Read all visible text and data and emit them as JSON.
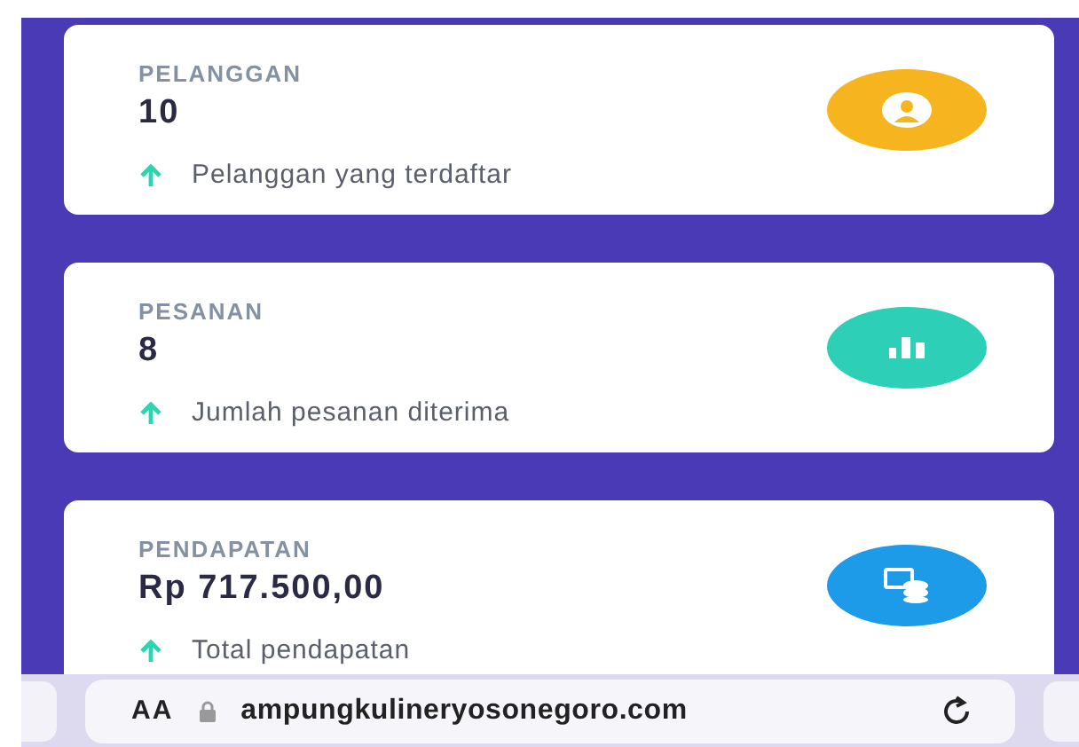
{
  "cards": [
    {
      "label": "PELANGGAN",
      "value": "10",
      "note": "Pelanggan yang terdaftar",
      "kind": "user",
      "color": "#f6b51f"
    },
    {
      "label": "PESANAN",
      "value": "8",
      "note": "Jumlah pesanan diterima",
      "kind": "chart",
      "color": "#2dcfb6"
    },
    {
      "label": "PENDAPATAN",
      "value": "Rp 717.500,00",
      "note": "Total pendapatan",
      "kind": "money",
      "color": "#1e9be8"
    }
  ],
  "address_bar": {
    "text_size": "AA",
    "url": "ampungkulineryosonegoro.com"
  }
}
